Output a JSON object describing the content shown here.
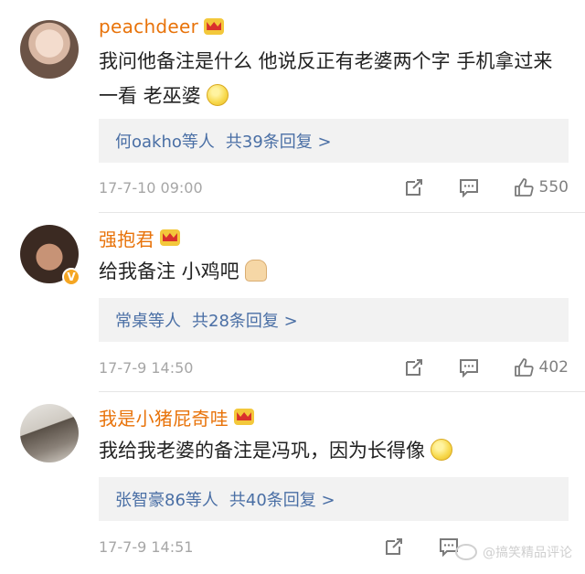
{
  "comments": [
    {
      "username": "peachdeer",
      "text": "我问他备注是什么 他说反正有老婆两个字 手机拿过来一看 老巫婆",
      "replies_label": "何oakho等人",
      "replies_count": "共39条回复 >",
      "time": "17-7-10 09:00",
      "likes": "550",
      "avatar_icon": "avatar-photo",
      "emoji": "smile-emoji"
    },
    {
      "username": "强抱君",
      "text": "给我备注 小鸡吧",
      "replies_label": "常桌等人",
      "replies_count": "共28条回复 >",
      "time": "17-7-9 14:50",
      "likes": "402",
      "avatar_icon": "avatar-photo",
      "verified_badge": "V",
      "emoji": "praying-hands-emoji"
    },
    {
      "username": "我是小猪屁奇哇",
      "text": "我给我老婆的备注是冯巩，因为长得像",
      "replies_label": "张智豪86等人",
      "replies_count": "共40条回复 >",
      "time": "17-7-9 14:51",
      "likes": "",
      "avatar_icon": "avatar-photo",
      "emoji": "smile-emoji"
    }
  ],
  "watermark": "@搞笑精品评论",
  "colors": {
    "username": "#e8730a",
    "link": "#4a6fa5",
    "meta": "#a6a6a6",
    "reply_bg": "#f2f2f2"
  },
  "icons": [
    "share-icon",
    "comment-icon",
    "like-icon",
    "crown-icon"
  ]
}
